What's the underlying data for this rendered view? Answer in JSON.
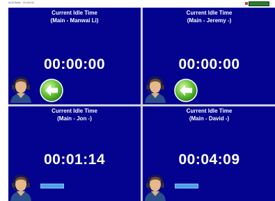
{
  "window": {
    "app_title": "ACDStats - 00:00:00",
    "colors": {
      "panel_bg": "#03038f",
      "divider": "#d0d0e0",
      "status_ok": "#2e7d32"
    }
  },
  "panels": [
    {
      "title": "Current Idle Time",
      "agent": "(Main - Manwai Li)",
      "timer": "00:00:00",
      "action_icon": "back-arrow-icon"
    },
    {
      "title": "Current Idle Time",
      "agent": "(Main - Jeremy -)",
      "timer": "00:00:00",
      "action_icon": "back-arrow-icon"
    },
    {
      "title": "Current Idle Time",
      "agent": "(Main - Jon -)",
      "timer": "00:01:14",
      "action_icon": "progress-bar"
    },
    {
      "title": "Current Idle Time",
      "agent": "(Main - David -)",
      "timer": "00:04:09",
      "action_icon": "progress-bar"
    }
  ]
}
